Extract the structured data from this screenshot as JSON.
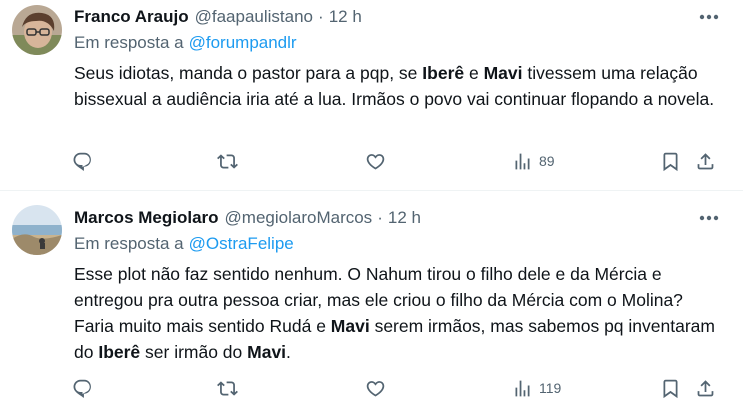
{
  "tweets": [
    {
      "author_name": "Franco Araujo",
      "handle": "@faapaulistano",
      "separator": "·",
      "time": "12 h",
      "reply_prefix": "Em resposta a",
      "reply_to": "@forumpandlr",
      "text_parts": [
        "Seus idiotas, manda o pastor para a pqp, se ",
        "Iberê",
        " e ",
        "Mavi",
        " tivessem uma relação bissexual a audiência iria até a lua. Irmãos o povo vai continuar flopando a novela."
      ],
      "views": "89"
    },
    {
      "author_name": "Marcos Megiolaro",
      "handle": "@megiolaroMarcos",
      "separator": "·",
      "time": "12 h",
      "reply_prefix": "Em resposta a",
      "reply_to": "@OstraFelipe",
      "text_parts": [
        "Esse plot não faz sentido nenhum. O Nahum tirou o filho dele e da Mércia e entregou pra outra pessoa criar, mas ele criou o filho da Mércia com o Molina? Faria muito mais sentido Rudá e ",
        "Mavi",
        " serem irmãos, mas sabemos pq inventaram do ",
        "Iberê",
        " ser irmão do ",
        "Mavi",
        "."
      ],
      "views": "119"
    }
  ],
  "icons": {
    "more": "more-horizontal-icon",
    "reply": "reply-icon",
    "retweet": "retweet-icon",
    "like": "heart-icon",
    "views": "views-chart-icon",
    "bookmark": "bookmark-icon",
    "share": "share-icon"
  },
  "colors": {
    "link": "#1d9bf0",
    "secondary_text": "#536471",
    "primary_text": "#0f1419",
    "divider": "#eff3f4"
  }
}
